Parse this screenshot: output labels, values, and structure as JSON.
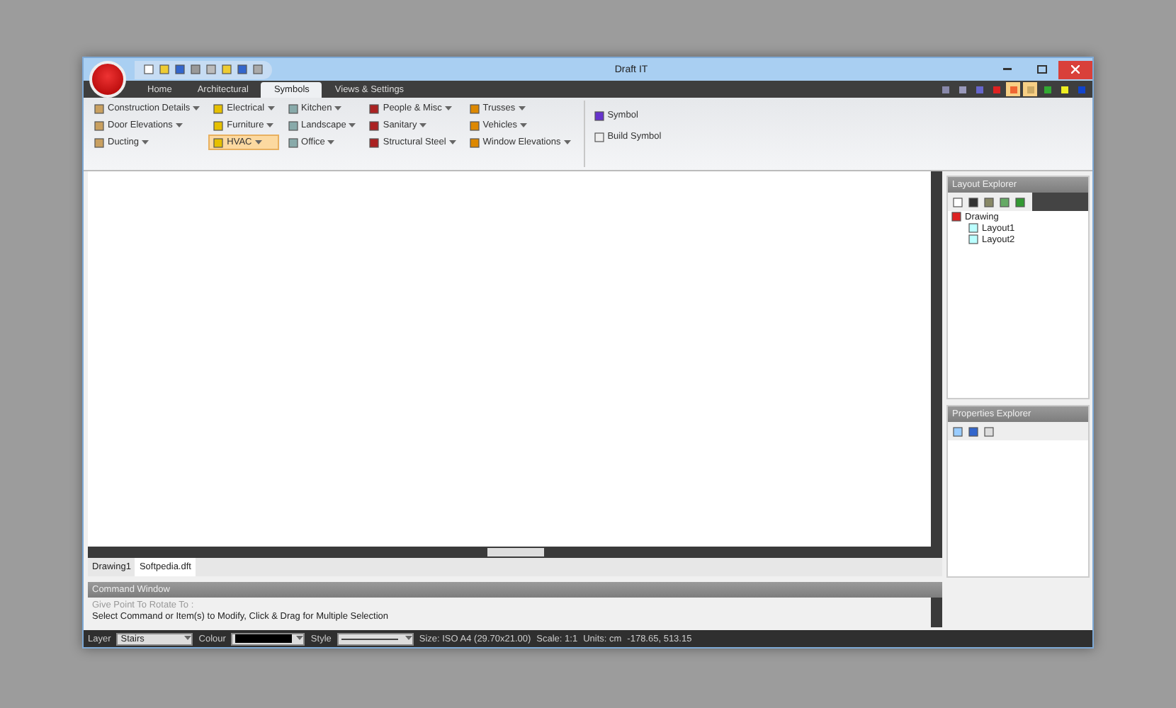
{
  "window": {
    "title": "Draft IT"
  },
  "ribbon_tabs": [
    {
      "label": "Home",
      "selected": false
    },
    {
      "label": "Architectural",
      "selected": false
    },
    {
      "label": "Symbols",
      "selected": true
    },
    {
      "label": "Views & Settings",
      "selected": false
    }
  ],
  "right_tools": [
    {
      "selected": false
    },
    {
      "selected": false
    },
    {
      "selected": false
    },
    {
      "selected": false
    },
    {
      "selected": true
    },
    {
      "selected": true
    },
    {
      "selected": false
    },
    {
      "selected": false
    },
    {
      "selected": false
    }
  ],
  "ribbon_columns": [
    [
      {
        "label": "Construction Details",
        "selected": false
      },
      {
        "label": "Door Elevations",
        "selected": false
      },
      {
        "label": "Ducting",
        "selected": false
      }
    ],
    [
      {
        "label": "Electrical",
        "selected": false
      },
      {
        "label": "Furniture",
        "selected": false
      },
      {
        "label": "HVAC",
        "selected": true
      }
    ],
    [
      {
        "label": "Kitchen",
        "selected": false
      },
      {
        "label": "Landscape",
        "selected": false
      },
      {
        "label": "Office",
        "selected": false
      }
    ],
    [
      {
        "label": "People & Misc",
        "selected": false
      },
      {
        "label": "Sanitary",
        "selected": false
      },
      {
        "label": "Structural Steel",
        "selected": false
      }
    ],
    [
      {
        "label": "Trusses",
        "selected": false
      },
      {
        "label": "Vehicles",
        "selected": false
      },
      {
        "label": "Window Elevations",
        "selected": false
      }
    ]
  ],
  "symbol_buttons": [
    {
      "label": "Symbol"
    },
    {
      "label": "Build Symbol"
    }
  ],
  "document_tabs": [
    {
      "label": "Drawing1",
      "selected": false
    },
    {
      "label": "Softpedia.dft",
      "selected": true
    }
  ],
  "layout_explorer": {
    "title": "Layout Explorer",
    "tree": [
      {
        "label": "Drawing",
        "children": [
          {
            "label": "Layout1"
          },
          {
            "label": "Layout2"
          }
        ]
      }
    ]
  },
  "properties_explorer": {
    "title": "Properties Explorer"
  },
  "command_window": {
    "title": "Command Window",
    "lines": [
      {
        "text": "Give Point To Rotate To :",
        "dim": true
      },
      {
        "text": "Select Command or Item(s) to Modify, Click & Drag for Multiple Selection",
        "dim": false
      }
    ]
  },
  "status_bar": {
    "layer_label": "Layer",
    "layer_value": "Stairs",
    "colour_label": "Colour",
    "color": "#000000",
    "style_label": "Style",
    "size": "Size: ISO A4 (29.70x21.00)",
    "scale": "Scale: 1:1",
    "units": "Units: cm",
    "coords": "-178.65, 513.15"
  }
}
